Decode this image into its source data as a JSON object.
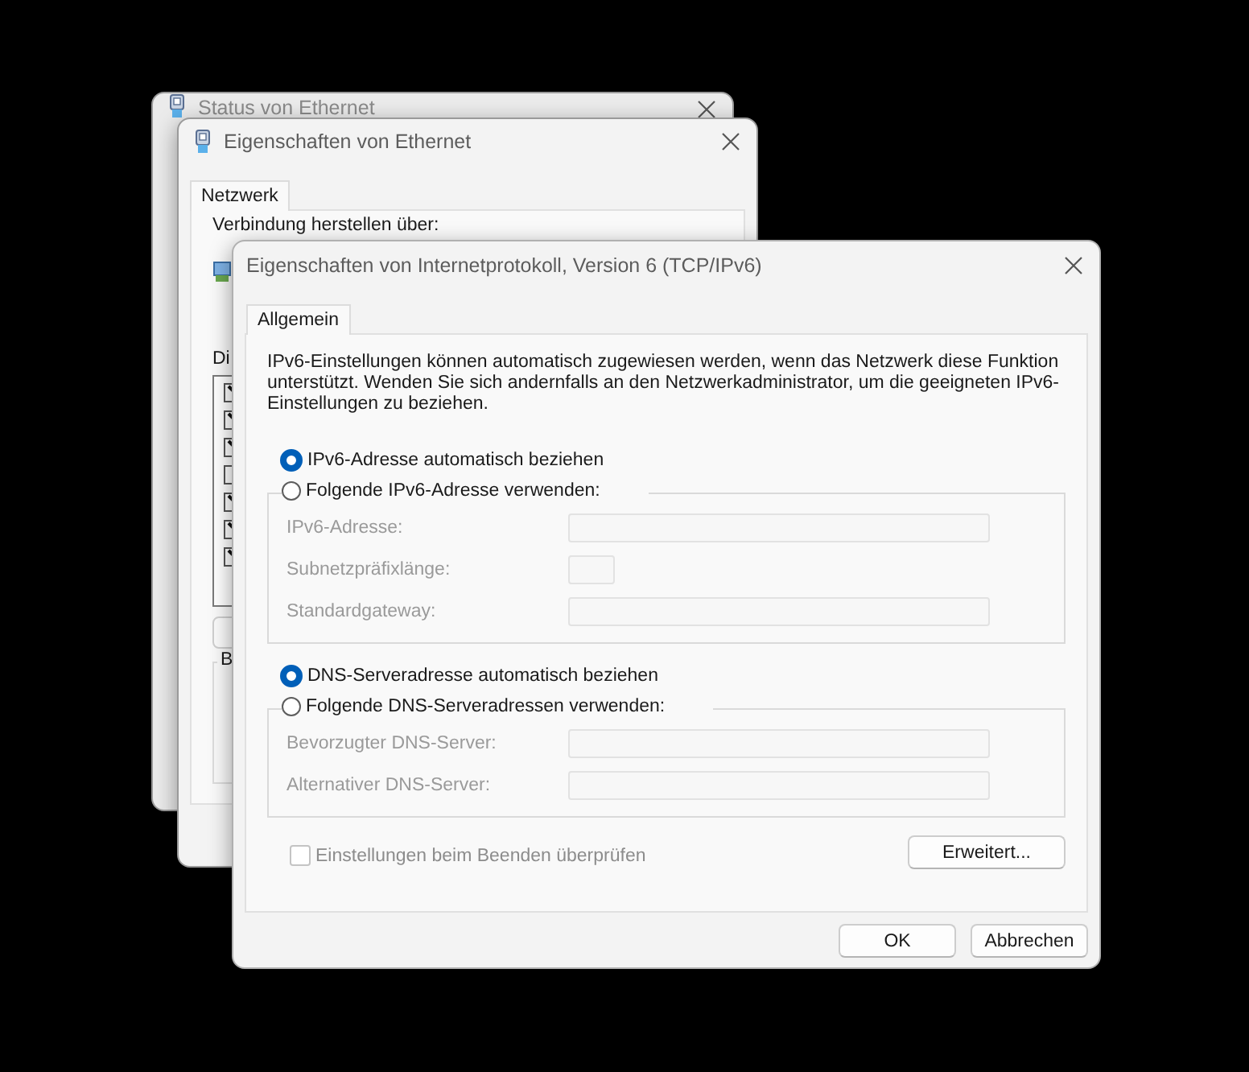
{
  "status_window": {
    "title": "Status von Ethernet"
  },
  "ethernet_window": {
    "title": "Eigenschaften von Ethernet",
    "tabs": [
      {
        "label": "Netzwerk",
        "selected": true
      }
    ],
    "connect_label": "Verbindung herstellen über:",
    "components_label": "Di",
    "components": [
      {
        "checked": true
      },
      {
        "checked": true
      },
      {
        "checked": true
      },
      {
        "checked": false
      },
      {
        "checked": true
      },
      {
        "checked": true
      },
      {
        "checked": true
      }
    ],
    "group_label": "B"
  },
  "ipv6_dialog": {
    "title": "Eigenschaften von Internetprotokoll, Version 6 (TCP/IPv6)",
    "tabs": [
      {
        "label": "Allgemein",
        "selected": true
      }
    ],
    "description": "IPv6-Einstellungen können automatisch zugewiesen werden, wenn das Netzwerk diese Funktion unterstützt. Wenden Sie sich andernfalls an den Netzwerkadministrator, um die geeigneten IPv6-Einstellungen zu beziehen.",
    "address_options": [
      {
        "label": "IPv6-Adresse automatisch beziehen",
        "selected": true
      },
      {
        "label": "Folgende IPv6-Adresse verwenden:",
        "selected": false
      }
    ],
    "address_fields": [
      {
        "label": "IPv6-Adresse:",
        "kind": "wide",
        "disabled": true
      },
      {
        "label": "Subnetzpräfixlänge:",
        "kind": "short",
        "disabled": true
      },
      {
        "label": "Standardgateway:",
        "kind": "wide",
        "disabled": true
      }
    ],
    "dns_options": [
      {
        "label": "DNS-Serveradresse automatisch beziehen",
        "selected": true
      },
      {
        "label": "Folgende DNS-Serveradressen verwenden:",
        "selected": false
      }
    ],
    "dns_fields": [
      {
        "label": "Bevorzugter DNS-Server:",
        "kind": "wide",
        "disabled": true
      },
      {
        "label": "Alternativer DNS-Server:",
        "kind": "wide",
        "disabled": true
      }
    ],
    "validate_checkbox": {
      "label": "Einstellungen beim Beenden überprüfen",
      "checked": false,
      "disabled": true
    },
    "advanced_button": "Erweitert...",
    "buttons": [
      "OK",
      "Abbrechen"
    ]
  }
}
